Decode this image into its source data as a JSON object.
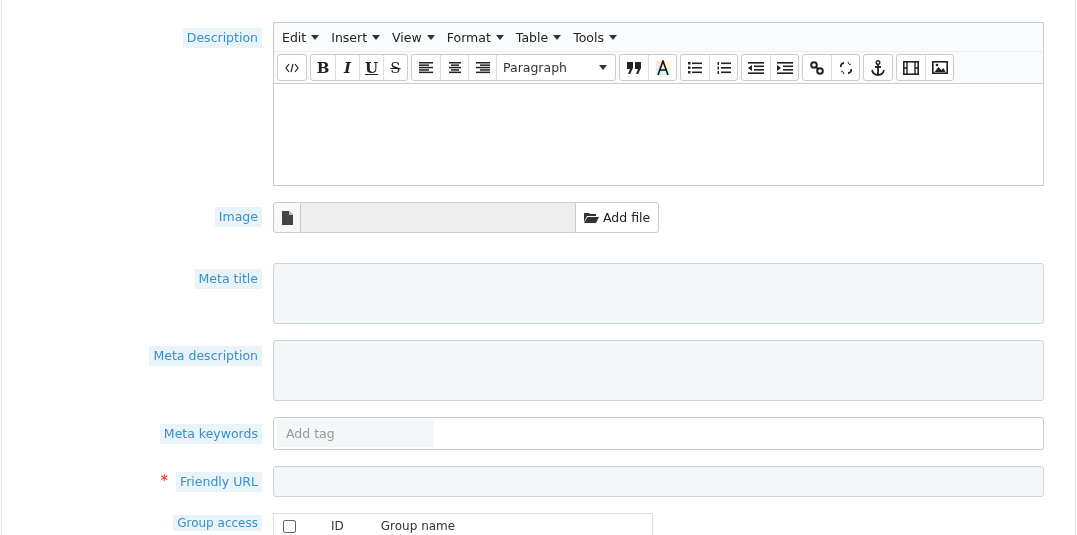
{
  "fields": [
    {
      "kind": "editor",
      "label": "Description",
      "required": false
    },
    {
      "kind": "file",
      "label": "Image",
      "required": false
    },
    {
      "kind": "textarea",
      "label": "Meta title",
      "required": false
    },
    {
      "kind": "textarea",
      "label": "Meta description",
      "required": false
    },
    {
      "kind": "tags",
      "label": "Meta keywords",
      "required": false
    },
    {
      "kind": "text",
      "label": "Friendly URL",
      "required": true
    },
    {
      "kind": "table",
      "label": "Group access",
      "required": false
    }
  ],
  "editor": {
    "menus": [
      "Edit",
      "Insert",
      "View",
      "Format",
      "Table",
      "Tools"
    ],
    "format_buttons": [
      "B",
      "I",
      "U",
      "S"
    ],
    "block_format": "Paragraph"
  },
  "file": {
    "button": "Add file"
  },
  "tags": {
    "placeholder": "Add tag"
  },
  "required_mark": "*",
  "group_table": {
    "all_checked": false,
    "columns": [
      "ID",
      "Group name"
    ]
  }
}
